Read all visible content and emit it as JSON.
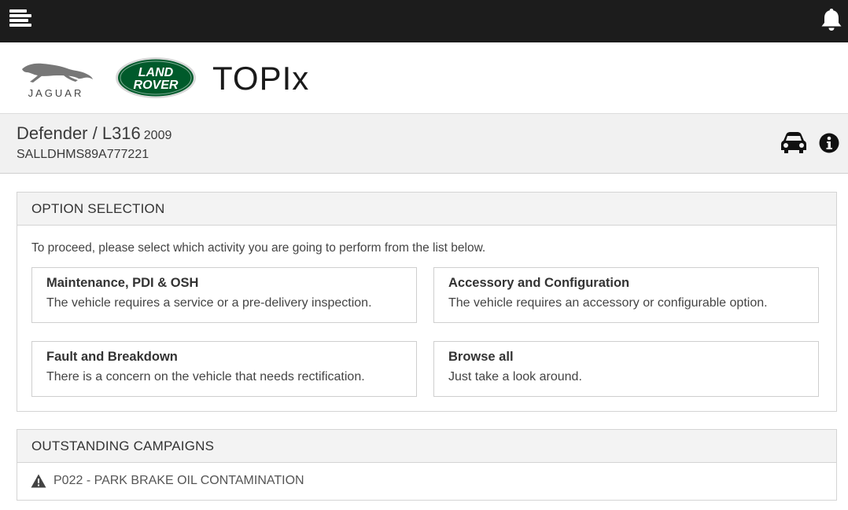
{
  "header": {
    "menu_icon": "hamburger-menu-icon",
    "notification_icon": "bell-icon"
  },
  "brands": {
    "jaguar_word": "JAGUAR",
    "land_rover_line1": "LAND",
    "land_rover_line2": "ROVER",
    "topix": "TOPIx"
  },
  "vehicle": {
    "model": "Defender / L316",
    "year": "2009",
    "vin": "SALLDHMS89A777221",
    "icons": [
      "car-icon",
      "info-icon"
    ]
  },
  "option_selection": {
    "title": "OPTION SELECTION",
    "intro": "To proceed, please select which activity you are going to perform from the list below.",
    "options": [
      {
        "title": "Maintenance, PDI & OSH",
        "description": "The vehicle requires a service or a pre-delivery inspection."
      },
      {
        "title": "Accessory and Configuration",
        "description": "The vehicle requires an accessory or configurable option."
      },
      {
        "title": "Fault and Breakdown",
        "description": "There is a concern on the vehicle that needs rectification."
      },
      {
        "title": "Browse all",
        "description": "Just take a look around."
      }
    ]
  },
  "campaigns": {
    "title": "OUTSTANDING CAMPAIGNS",
    "items": [
      {
        "icon": "warning-icon",
        "text": "P022 - PARK BRAKE OIL CONTAMINATION"
      }
    ]
  },
  "colors": {
    "topbar": "#1c1c1c",
    "land_rover_green": "#005a2b",
    "panel_header": "#f3f3f3",
    "vehicle_bar": "#f1f1f1"
  }
}
